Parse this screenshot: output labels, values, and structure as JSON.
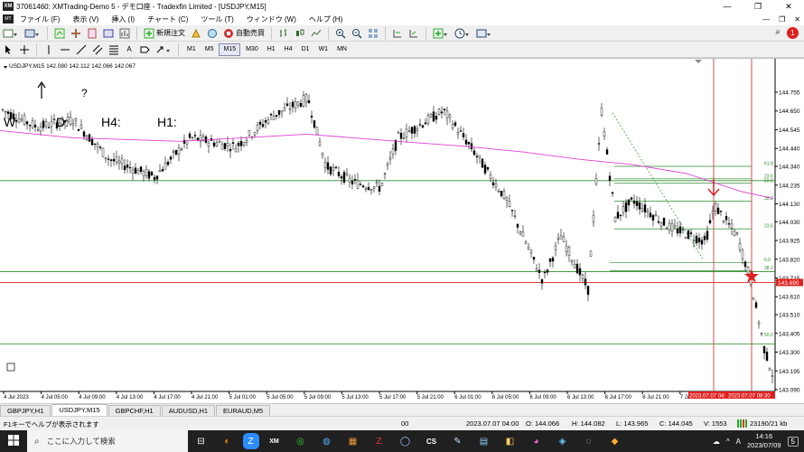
{
  "window": {
    "app_icon": "XM",
    "title": "37061460: XMTrading-Demo 5 - デモ口座 - Tradexfin Limited - [USDJPY,M15]",
    "controls": [
      "—",
      "❐",
      "✕"
    ]
  },
  "menu": {
    "items": [
      "ファイル (F)",
      "表示 (V)",
      "挿入 (I)",
      "チャート (C)",
      "ツール (T)",
      "ウィンドウ (W)",
      "ヘルプ (H)"
    ],
    "doc_icon": "MT",
    "doc_controls": [
      "—",
      "❐",
      "✕"
    ]
  },
  "toolbar": {
    "new_order": "新規注文",
    "auto_trade": "自動売買",
    "timeframes": [
      "M1",
      "M5",
      "M15",
      "M30",
      "H1",
      "H4",
      "D1",
      "W1",
      "MN"
    ],
    "selected_timeframe": "M15",
    "text_tool": "A",
    "notification_count": "1"
  },
  "chart": {
    "symbol_info": "USDJPY,M15  142.080 142.112 142.066 142.067",
    "overlay_labels": [
      "W",
      "D:",
      "H4:",
      "H1:",
      "?"
    ],
    "price_labels": [
      "144.755",
      "144.650",
      "144.545",
      "144.440",
      "144.340",
      "144.235",
      "144.130",
      "144.030",
      "143.925",
      "143.820",
      "143.715",
      "143.610",
      "143.510",
      "143.405",
      "143.300",
      "143.195",
      "143.090"
    ],
    "current_price_tag": "143.690",
    "time_labels": [
      "4 Jul 2023",
      "4 Jul 05:00",
      "4 Jul 09:00",
      "4 Jul 13:00",
      "4 Jul 17:00",
      "4 Jul 21:00",
      "5 Jul 01:00",
      "5 Jul 05:00",
      "5 Jul 09:00",
      "5 Jul 13:00",
      "5 Jul 17:00",
      "5 Jul 21:00",
      "6 Jul 01:00",
      "6 Jul 05:00",
      "6 Jul 09:00",
      "6 Jul 13:00",
      "6 Jul 17:00",
      "6 Jul 21:00",
      "7 Jul"
    ],
    "vline_labels": [
      "2023.07.07 04:",
      "2023.07.07 08:30"
    ],
    "fib_labels": [
      "61.8",
      "23.6",
      "50.0",
      "38.2",
      "23.6",
      "0.0",
      "38.2",
      "50.0"
    ],
    "colors": {
      "candle": "#000000",
      "ma": "#e040d0",
      "hline_green": "#2e8b2e",
      "hline_red": "#e02020",
      "vline": "#e02020",
      "fib": "#2e8b2e",
      "trend": "#3aa53a",
      "price_tag": "#e02020"
    }
  },
  "tabs": {
    "items": [
      "GBPJPY,H1",
      "USDJPY,M15",
      "GBPCHF,H1",
      "AUDUSD,H1",
      "EURAUD,M5"
    ],
    "active_index": 1
  },
  "status": {
    "help": "F1キーでヘルプが表示されます",
    "profile": "00",
    "datetime": "2023.07.07 04:00",
    "open": "O: 144.066",
    "high": "H: 144.082",
    "low": "L: 143.965",
    "close": "C: 144.045",
    "volume": "V: 1553",
    "traffic": "23190/21 kb"
  },
  "taskbar": {
    "search_placeholder": "ここに入力して検索",
    "apps": [
      "⊟",
      "◐",
      "Z",
      "XM",
      "◎",
      "◍",
      "▦",
      "Z",
      "◯",
      "CS",
      "✎",
      "▤",
      "◧",
      "◕",
      "◈",
      "◌",
      "◆"
    ],
    "tray": {
      "weather": "☁",
      "chevron": "^",
      "ime": "A",
      "time": "14:16",
      "date": "2023/07/09",
      "notif": "5"
    }
  }
}
